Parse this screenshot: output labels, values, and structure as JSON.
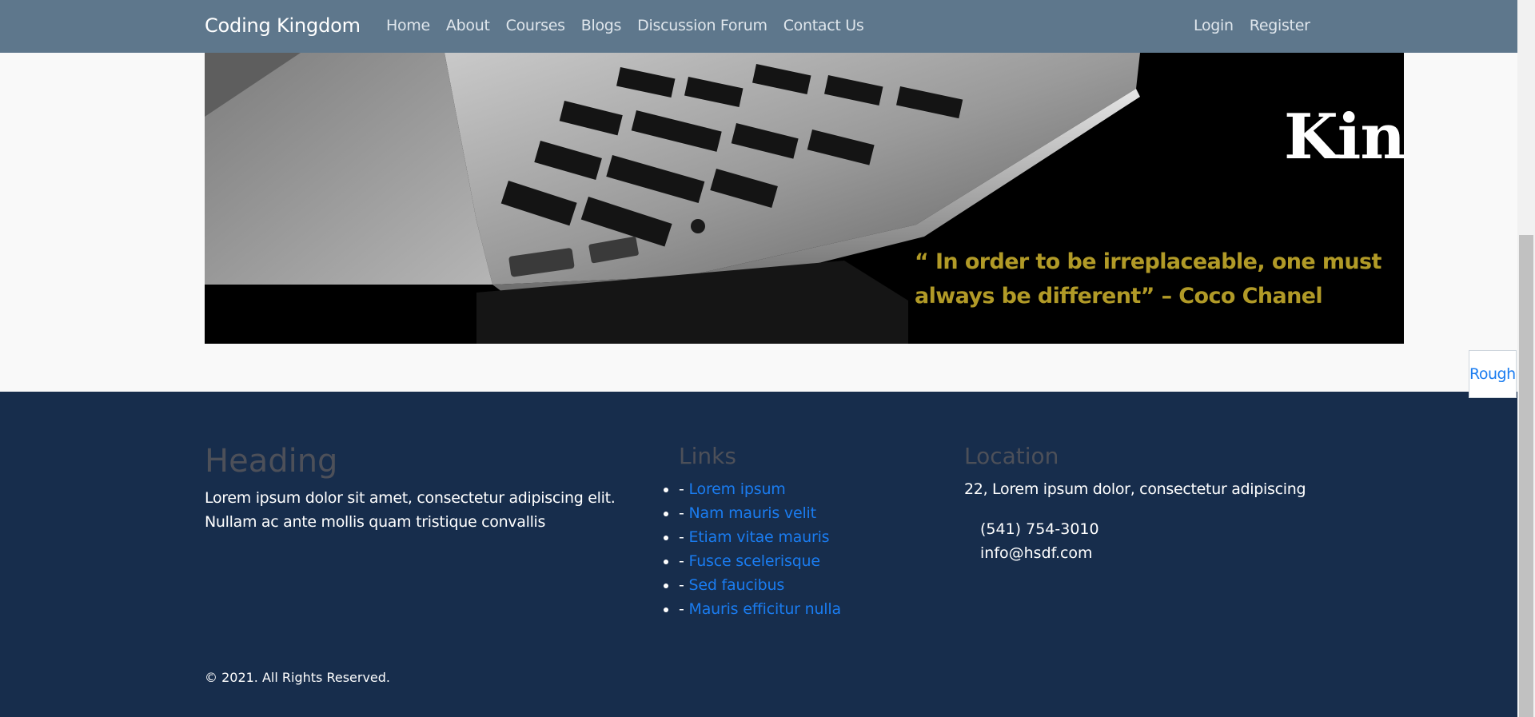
{
  "navbar": {
    "brand": "Coding Kingdom",
    "links": [
      "Home",
      "About",
      "Courses",
      "Blogs",
      "Discussion Forum",
      "Contact Us"
    ],
    "auth": {
      "login": "Login",
      "register": "Register"
    }
  },
  "hero": {
    "title": "Kingdom",
    "quote_line1": "“ In order to be irreplaceable, one must",
    "quote_line2": "always be different”   – Coco Chanel"
  },
  "footer": {
    "col1": {
      "heading": "Heading",
      "text": "Lorem ipsum dolor sit amet, consectetur adipiscing elit. Nullam ac ante mollis quam tristique convallis"
    },
    "col2": {
      "heading": "Links",
      "dash": "- ",
      "items": [
        "Lorem ipsum",
        "Nam mauris velit",
        "Etiam vitae mauris",
        "Fusce scelerisque",
        "Sed faucibus",
        "Mauris efficitur nulla"
      ]
    },
    "col3": {
      "heading": "Location",
      "address": "22, Lorem ipsum dolor, consectetur adipiscing",
      "phone": "(541) 754-3010",
      "email": "info@hsdf.com"
    },
    "copyright": "© 2021. All Rights Reserved."
  },
  "widget": {
    "label": "Rough"
  },
  "colors": {
    "navbar_bg": "#5e778c",
    "footer_bg": "#172d4c",
    "link": "#1a7cf0",
    "quote": "#b19a27",
    "heading_muted": "#4d5059"
  }
}
